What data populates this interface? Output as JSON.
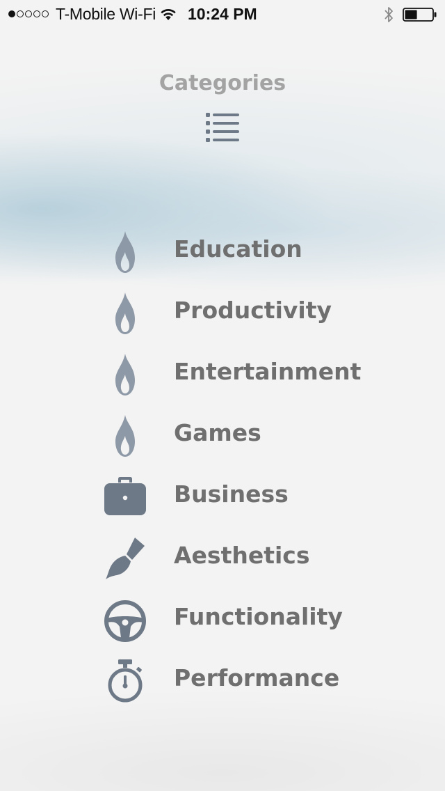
{
  "status_bar": {
    "signal_bars_filled": 1,
    "signal_bars_total": 5,
    "carrier": "T-Mobile Wi-Fi",
    "time": "10:24 PM",
    "bluetooth_icon": "bluetooth-icon",
    "battery_level": 0.45
  },
  "header": {
    "title": "Categories",
    "icon": "list-icon"
  },
  "categories": [
    {
      "label": "Education",
      "icon": "flame-icon"
    },
    {
      "label": "Productivity",
      "icon": "flame-icon"
    },
    {
      "label": "Entertainment",
      "icon": "flame-icon"
    },
    {
      "label": "Games",
      "icon": "flame-icon"
    },
    {
      "label": "Business",
      "icon": "briefcase-icon"
    },
    {
      "label": "Aesthetics",
      "icon": "paintbrush-icon"
    },
    {
      "label": "Functionality",
      "icon": "steering-wheel-icon"
    },
    {
      "label": "Performance",
      "icon": "stopwatch-icon"
    }
  ],
  "colors": {
    "icon_grey": "#6e7987",
    "flame_grey": "#8e99a7",
    "label_grey": "#6f6f6f",
    "title_grey": "#a3a3a3"
  }
}
